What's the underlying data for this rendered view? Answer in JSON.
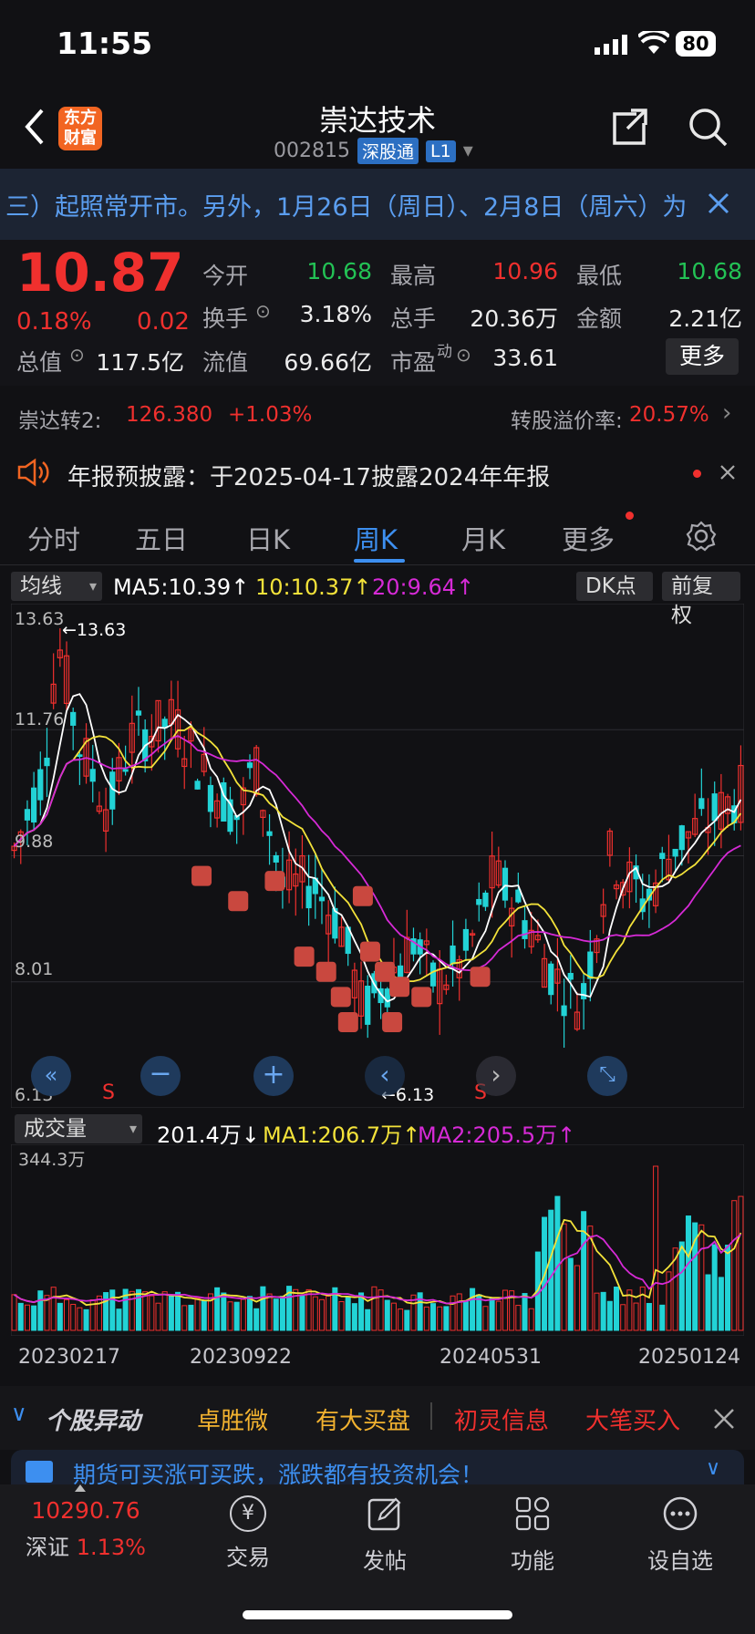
{
  "status": {
    "time": "11:55",
    "battery": "80"
  },
  "nav": {
    "title": "崇达技术",
    "code": "002815",
    "tag": "深股通",
    "level": "L1",
    "brand_line1": "东方",
    "brand_line2": "财富"
  },
  "notice": {
    "text": "三）起照常开市。另外，1月26日（周日）、2月8日（周六）为"
  },
  "quote": {
    "price": "10.87",
    "change_pct": "0.18%",
    "change": "0.02",
    "rows": [
      [
        {
          "label": "今开",
          "value": "10.68",
          "color": "green"
        },
        {
          "label": "最高",
          "value": "10.96",
          "color": "red"
        },
        {
          "label": "最低",
          "value": "10.68",
          "color": "green"
        }
      ],
      [
        {
          "label": "换手",
          "value": "3.18%",
          "color": "white"
        },
        {
          "label": "总手",
          "value": "20.36万",
          "color": "white"
        },
        {
          "label": "金额",
          "value": "2.21亿",
          "color": "white"
        }
      ]
    ],
    "row3": {
      "zongzhi_label": "总值",
      "zongzhi": "117.5亿",
      "liuzhi_label": "流值",
      "liuzhi": "69.66亿",
      "shiying_label": "市盈",
      "shiying_sup": "动",
      "shiying": "33.61"
    },
    "more": "更多"
  },
  "convertible": {
    "name": "崇达转2:",
    "price": "126.380",
    "pct": "+1.03%",
    "premium_label": "转股溢价率:",
    "premium": "20.57%"
  },
  "announcement": {
    "text": "年报预披露：于2025-04-17披露2024年年报"
  },
  "tabs": [
    "分时",
    "五日",
    "日K",
    "周K",
    "月K",
    "更多"
  ],
  "chart_header": {
    "indicator": "均线",
    "ma5": "MA5:10.39↑",
    "ma10": "10:10.37↑",
    "ma20": "20:9.64↑",
    "dk": "DK点",
    "adjust": "前复权"
  },
  "colors": {
    "up": "#f0302e",
    "down": "#22d3d6",
    "ma5": "#ffffff",
    "ma10": "#f3e23a",
    "ma20": "#d62ad6",
    "accent": "#3d8ff0"
  },
  "chart_data": {
    "type": "candlestick",
    "price_axis": [
      "13.63",
      "11.76",
      "9.88",
      "8.01",
      "6.13"
    ],
    "ylim": [
      6.13,
      13.63
    ],
    "high_label": "13.63",
    "low_label": "6.13",
    "signals": [
      "S",
      "S"
    ]
  },
  "volume": {
    "indicator": "成交量",
    "value": "201.4万↓",
    "ma1": "MA1:206.7万↑",
    "ma2": "MA2:205.5万↑",
    "max": "344.3万"
  },
  "dates": [
    "20230217",
    "20230922",
    "20240531",
    "20250124"
  ],
  "alerts": {
    "title": "个股异动",
    "items": [
      {
        "text": "卓胜微",
        "color": "#f2b230"
      },
      {
        "text": "有大买盘",
        "color": "#f2b230"
      },
      {
        "text": "初灵信息",
        "color": "#f0302e"
      },
      {
        "text": "大笔买入",
        "color": "#f0302e"
      }
    ]
  },
  "promo": {
    "text": "期货可买涨可买跌，涨跌都有投资机会！"
  },
  "bottom_nav": {
    "index_value": "10290.76",
    "index_name": "深证",
    "index_pct": "1.13%",
    "items": [
      "交易",
      "发帖",
      "功能",
      "设自选"
    ]
  }
}
